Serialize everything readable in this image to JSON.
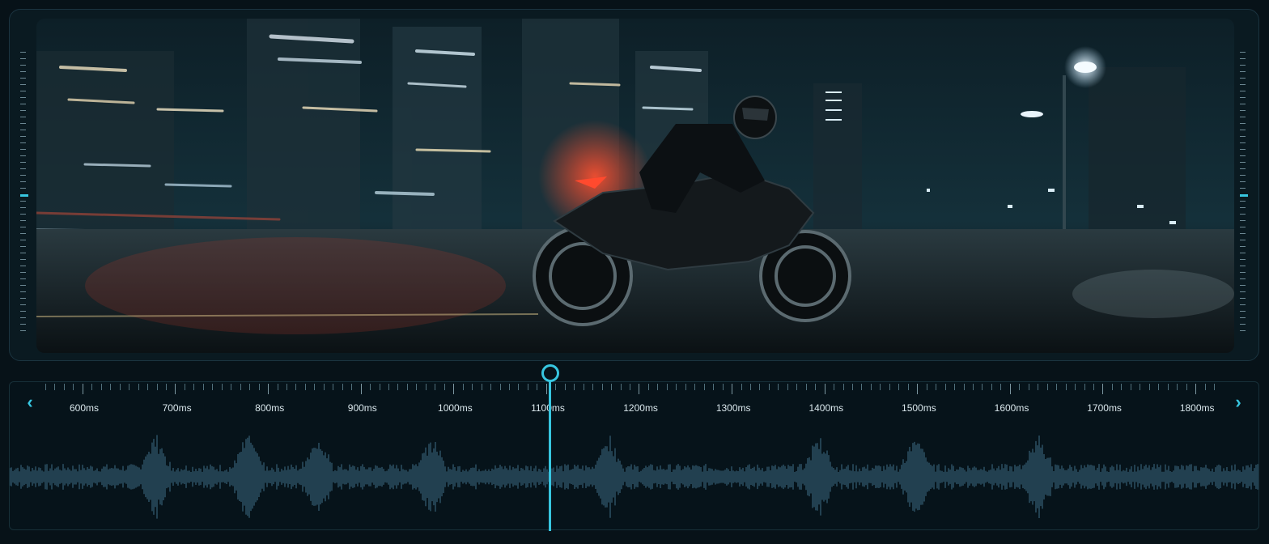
{
  "preview": {
    "description_icon": "video-frame"
  },
  "timeline": {
    "prev_icon": "chevron-left-icon",
    "next_icon": "chevron-right-icon",
    "labels": [
      "600ms",
      "700ms",
      "800ms",
      "900ms",
      "1000ms",
      "1100ms",
      "1200ms",
      "1300ms",
      "1400ms",
      "1500ms",
      "1600ms",
      "1700ms",
      "1800ms"
    ],
    "playhead_time_ms": 1100
  },
  "colors": {
    "accent": "#37c6e0",
    "waveform": "#3d6d86",
    "background": "#071218"
  }
}
